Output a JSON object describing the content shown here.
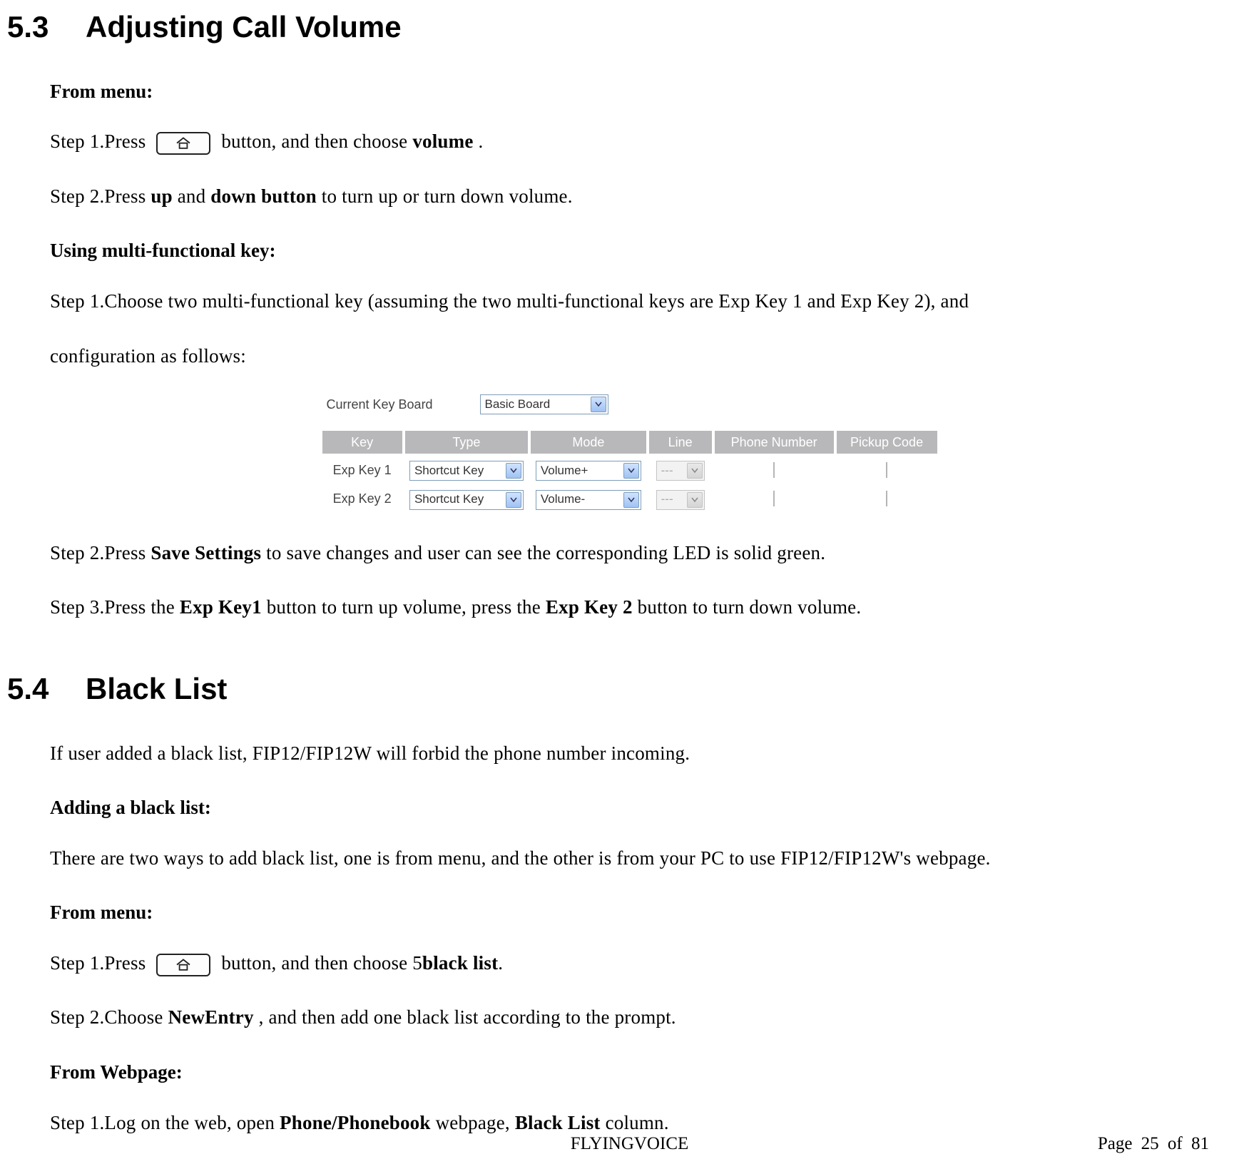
{
  "section53": {
    "num": "5.3",
    "title": "Adjusting Call Volume",
    "from_menu": "From menu:",
    "step1_a": "Step 1.Press ",
    "step1_b": " button, and then choose ",
    "step1_c": "volume",
    "step1_d": ".",
    "step2_a": "Step 2.Press ",
    "step2_b": "up",
    "step2_c": " and ",
    "step2_d": "down button",
    "step2_e": " to turn up or turn down volume.",
    "using_key": "Using multi-functional key:",
    "mk_step1": "Step 1.Choose two multi-functional key (assuming the two multi-functional keys are Exp Key 1 and Exp Key 2), and",
    "mk_step1b": "configuration as follows:",
    "mk_step2_a": "Step 2.Press ",
    "mk_step2_b": "Save Settings",
    "mk_step2_c": " to save changes and user can see the corresponding LED is solid green.",
    "mk_step3_a": "Step 3.Press the ",
    "mk_step3_b": "Exp Key1",
    "mk_step3_c": " button to turn up volume, press the ",
    "mk_step3_d": "Exp Key 2",
    "mk_step3_e": " button to turn down volume."
  },
  "figure": {
    "top_label": "Current Key Board",
    "top_value": "Basic Board",
    "headers": {
      "key": "Key",
      "type": "Type",
      "mode": "Mode",
      "line": "Line",
      "phone": "Phone Number",
      "pickup": "Pickup Code"
    },
    "rows": [
      {
        "key": "Exp Key 1",
        "type": "Shortcut Key",
        "mode": "Volume+",
        "line": "---",
        "phone": "",
        "pickup": ""
      },
      {
        "key": "Exp Key 2",
        "type": "Shortcut Key",
        "mode": "Volume-",
        "line": "---",
        "phone": "",
        "pickup": ""
      }
    ]
  },
  "section54": {
    "num": "5.4",
    "title": "Black List",
    "intro": "If user added a black list, FIP12/FIP12W will forbid the phone number incoming.",
    "adding": "Adding a black list:",
    "two_ways": "There are two ways to add black list, one is from menu, and the other is from your PC to use FIP12/FIP12W's webpage.",
    "from_menu": "From menu:",
    "m_step1_a": "Step 1.Press ",
    "m_step1_b": " button, and then choose 5",
    "m_step1_c": "black list",
    "m_step1_d": ".",
    "m_step2_a": "Step 2.Choose ",
    "m_step2_b": "NewEntry",
    "m_step2_c": ", and then add one black list according to the prompt.",
    "from_web": "From Webpage:",
    "w_step1_a": "Step 1.Log on the web, open ",
    "w_step1_b": "Phone/Phonebook",
    "w_step1_c": " webpage, ",
    "w_step1_d": "Black List",
    "w_step1_e": " column."
  },
  "footer": {
    "center": "FLYINGVOICE",
    "right": "Page 25 of 81"
  },
  "icons": {
    "home": "home-icon",
    "chevron": "chevron-down-icon"
  }
}
